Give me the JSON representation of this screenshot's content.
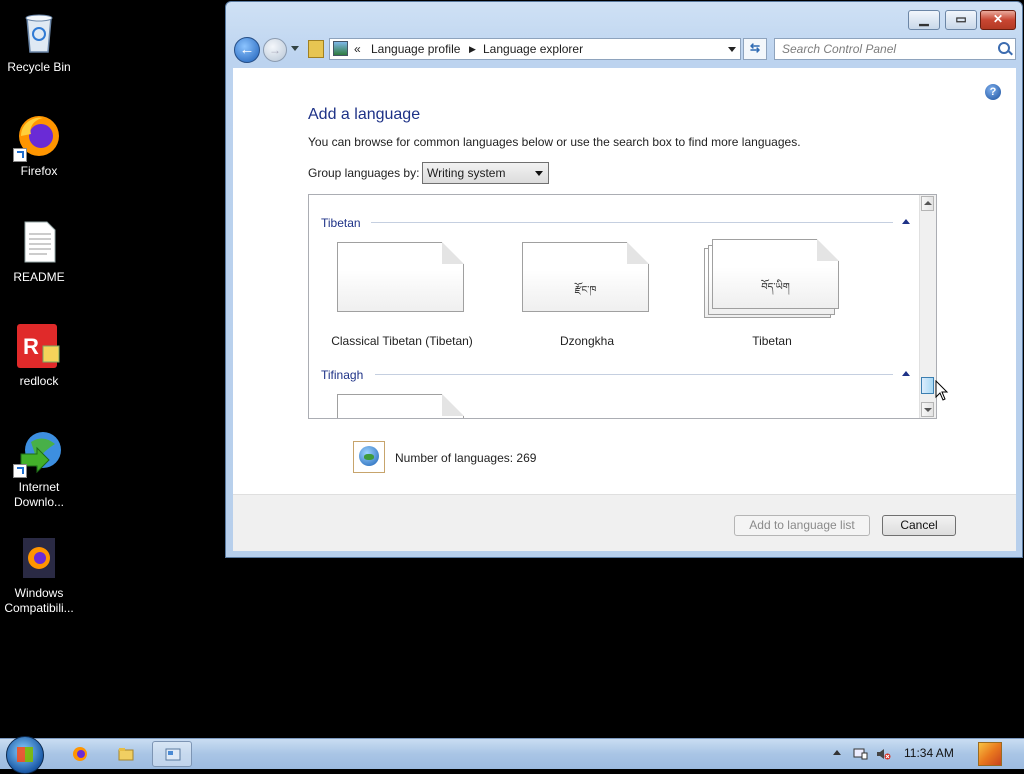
{
  "desktop": {
    "icons": [
      {
        "label": "Recycle Bin",
        "icon": "recycle-bin-icon"
      },
      {
        "label": "Firefox",
        "icon": "firefox-icon"
      },
      {
        "label": "README",
        "icon": "text-document-icon"
      },
      {
        "label": "redlock",
        "icon": "redlock-icon"
      },
      {
        "label": "Internet\nDownlo...",
        "icon": "internet-download-manager-icon"
      },
      {
        "label": "Windows\nCompatibili...",
        "icon": "firefox-shortcut-icon"
      }
    ]
  },
  "window": {
    "breadcrumb": {
      "overflow": "«",
      "items": [
        "Language profile",
        "Language explorer"
      ]
    },
    "search": {
      "placeholder": "Search Control Panel"
    },
    "help_glyph": "?",
    "heading": "Add a language",
    "description": "You can browse for common languages below or use the search box to find more languages.",
    "group_by": {
      "label": "Group languages by:",
      "value": "Writing system"
    },
    "groups": [
      {
        "name": "Tibetan",
        "tiles": [
          {
            "name": "Classical Tibetan (Tibetan)",
            "sample": "",
            "stacked": false
          },
          {
            "name": "Dzongkha",
            "sample": "རྫོང་ཁ",
            "stacked": false
          },
          {
            "name": "Tibetan",
            "sample": "བོད་ཡིག",
            "stacked": true
          }
        ]
      },
      {
        "name": "Tifinagh",
        "tiles": []
      }
    ],
    "count_text": "Number of languages: 269",
    "buttons": {
      "add": "Add to language list",
      "cancel": "Cancel"
    }
  },
  "taskbar": {
    "clock": "11:34 AM"
  },
  "colors": {
    "heading": "#1e3287",
    "window_frame": "#bcd3ef",
    "close_button": "#c84632"
  }
}
